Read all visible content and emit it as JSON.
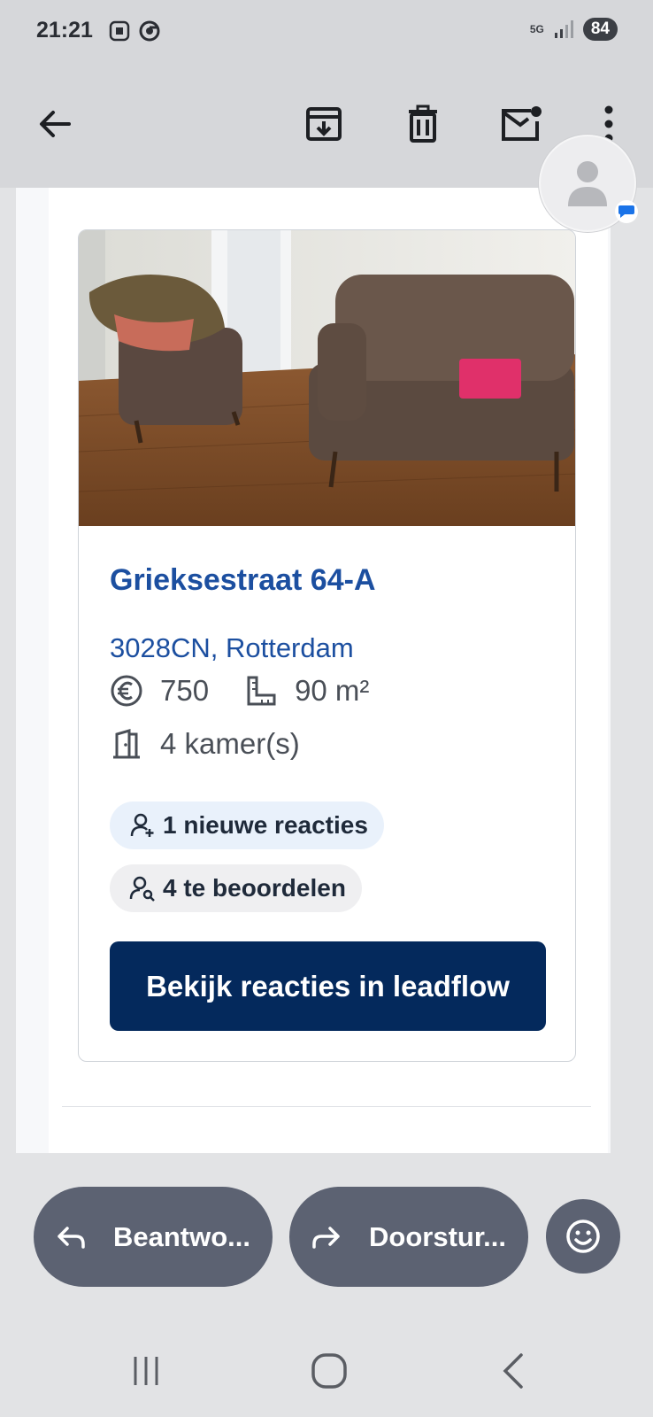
{
  "status_bar": {
    "time": "21:21",
    "network": "5G",
    "battery": "84"
  },
  "toolbar": {
    "icons": [
      "back-arrow-icon",
      "archive-icon",
      "delete-icon",
      "mark-unread-icon",
      "more-options-icon"
    ]
  },
  "listing": {
    "street": "Grieksestraat 64-A",
    "city": "3028CN, Rotterdam",
    "price": "750",
    "area": "90 m²",
    "rooms": "4 kamer(s)",
    "new_reactions": "1 nieuwe reacties",
    "to_review": "4 te beoordelen",
    "cta_label": "Bekijk reacties in leadflow"
  },
  "actions": {
    "reply_label": "Beantwo...",
    "forward_label": "Doorstur..."
  },
  "colors": {
    "accent_blue": "#1c4fa0",
    "cta_navy": "#04295c",
    "action_grey": "#5c6272"
  }
}
